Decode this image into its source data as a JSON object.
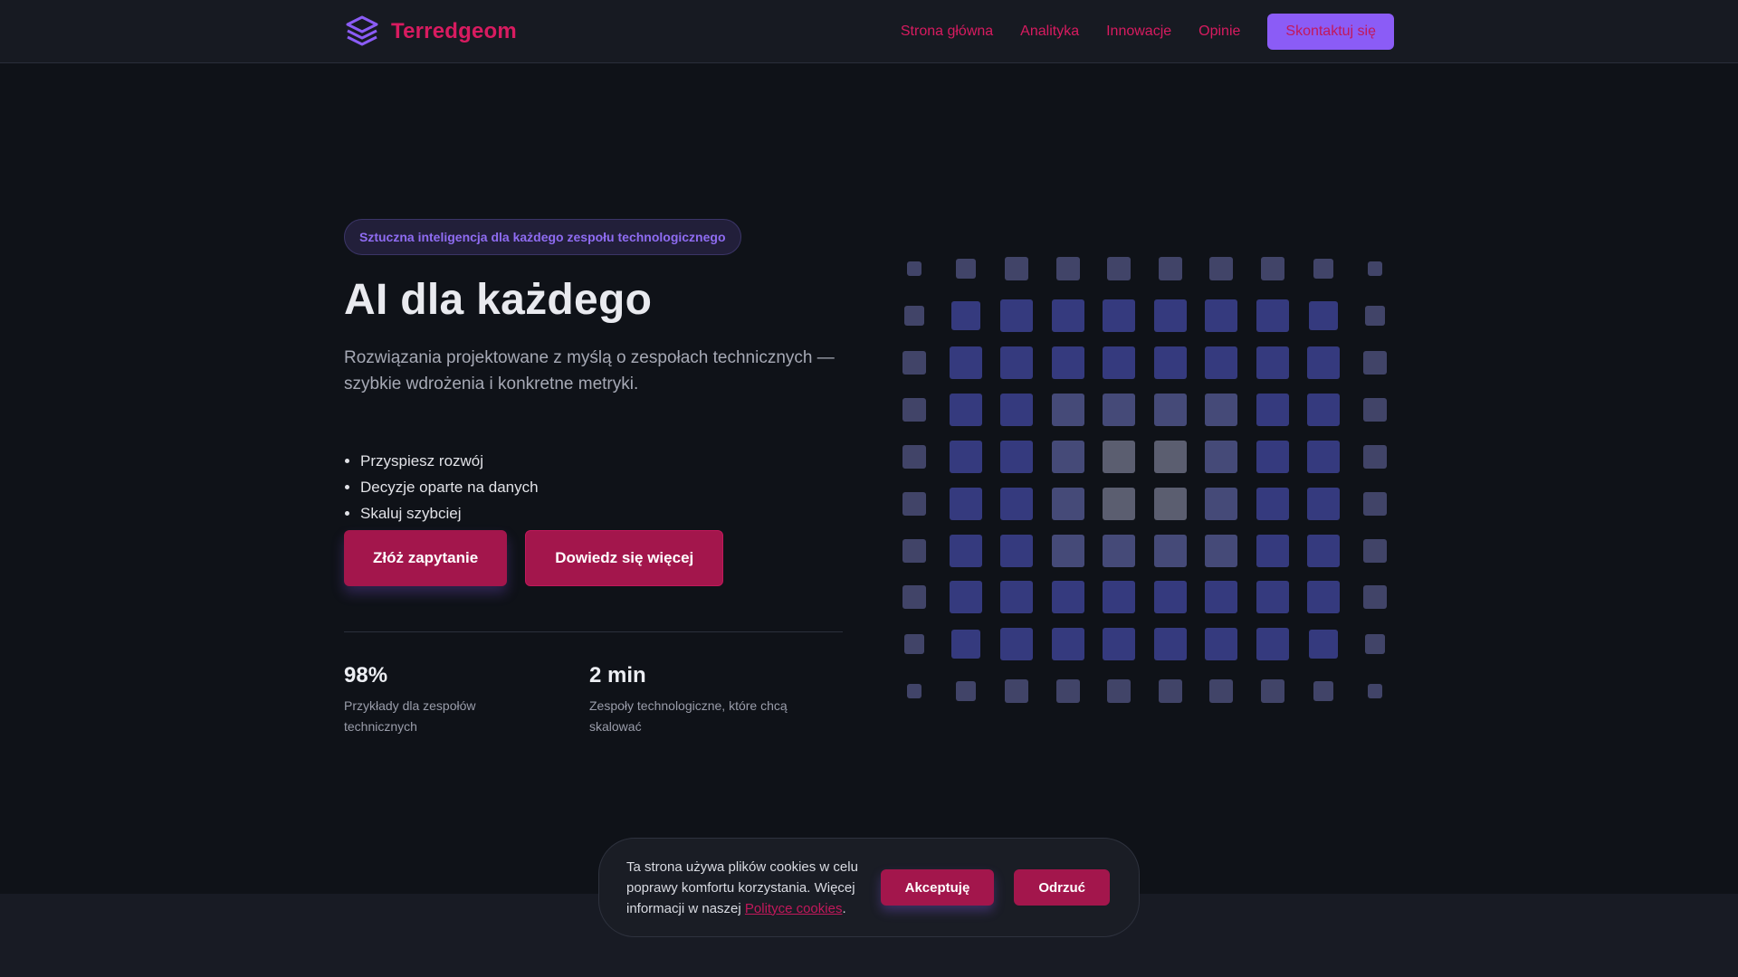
{
  "brand": {
    "name": "Terredgeom",
    "logo_icon": "layers-icon",
    "accent": "#d81b60",
    "purple": "#8b5cf6"
  },
  "nav": {
    "items": [
      "Strona główna",
      "Analityka",
      "Innowacje",
      "Opinie"
    ],
    "cta": "Skontaktuj się"
  },
  "hero": {
    "badge": "Sztuczna inteligencja dla każdego zespołu technologicznego",
    "title": "AI dla każdego",
    "subtitle": "Rozwiązania projektowane z myślą o zespołach technicznych — szybkie wdrożenia i konkretne metryki.",
    "bullets": [
      "Przyspiesz rozwój",
      "Decyzje oparte na danych",
      "Skaluj szybciej"
    ],
    "primary_button": "Złóż zapytanie",
    "secondary_button": "Dowiedz się więcej"
  },
  "stats": [
    {
      "value": "98%",
      "label": "Przykłady dla zespołów technicznych"
    },
    {
      "value": "2 min",
      "label": "Zespoły technologiczne, które chcą skalować"
    }
  ],
  "cookie": {
    "text_before": "Ta strona używa plików cookies w celu poprawy komfortu korzystania. Więcej informacji w naszej ",
    "link": "Polityce cookies",
    "text_after": ".",
    "accept": "Akceptuję",
    "reject": "Odrzuć"
  }
}
